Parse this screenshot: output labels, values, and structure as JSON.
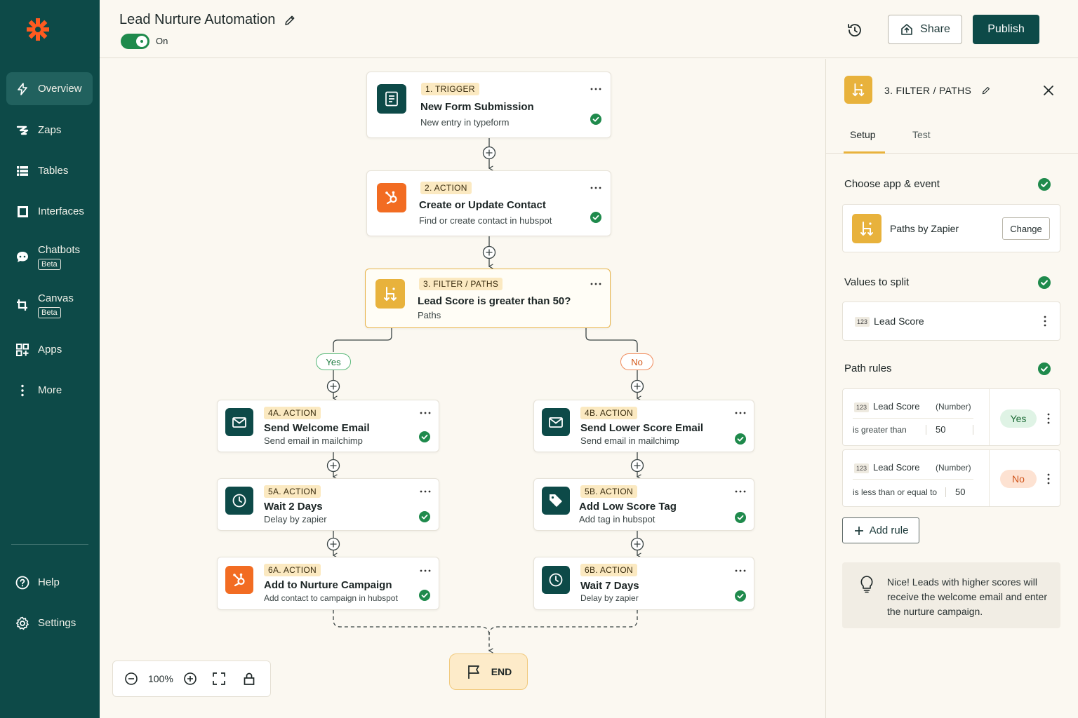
{
  "sidebar": {
    "items": [
      {
        "label": "Overview",
        "icon": "bolt-icon"
      },
      {
        "label": "Zaps",
        "icon": "zap-icon"
      },
      {
        "label": "Tables",
        "icon": "tables-icon"
      },
      {
        "label": "Interfaces",
        "icon": "interfaces-icon"
      },
      {
        "label": "Chatbots",
        "badge": "Beta",
        "icon": "chatbot-icon"
      },
      {
        "label": "Canvas",
        "badge": "Beta",
        "icon": "canvas-icon"
      },
      {
        "label": "Apps",
        "icon": "apps-icon"
      },
      {
        "label": "More",
        "icon": "more-vertical-icon"
      }
    ],
    "footer": [
      {
        "label": "Help",
        "icon": "help-icon"
      },
      {
        "label": "Settings",
        "icon": "gear-icon"
      }
    ]
  },
  "header": {
    "title": "Lead Nurture Automation",
    "toggle_label": "On",
    "share_label": "Share",
    "publish_label": "Publish"
  },
  "steps": {
    "s1": {
      "label": "1. TRIGGER",
      "title": "New Form Submission",
      "sub": "New entry in typeform"
    },
    "s2": {
      "label": "2. ACTION",
      "title": "Create or Update Contact",
      "sub": "Find or create contact in hubspot"
    },
    "s3": {
      "label": "3. FILTER / PATHS",
      "title": "Lead Score is greater than 50?",
      "sub": "Paths"
    },
    "s4a": {
      "label": "4A. ACTION",
      "title": "Send Welcome Email",
      "sub": "Send email in mailchimp"
    },
    "s5a": {
      "label": "5A. ACTION",
      "title": "Wait 2 Days",
      "sub": "Delay by zapier"
    },
    "s6a": {
      "label": "6A. ACTION",
      "title": "Add to Nurture Campaign",
      "sub": "Add contact to campaign in hubspot"
    },
    "s4b": {
      "label": "4B. ACTION",
      "title": "Send Lower Score Email",
      "sub": "Send email in mailchimp"
    },
    "s5b": {
      "label": "5B. ACTION",
      "title": "Add Low Score Tag",
      "sub": "Add tag in hubspot"
    },
    "s6b": {
      "label": "6B. ACTION",
      "title": "Wait 7 Days",
      "sub": "Delay by zapier"
    }
  },
  "branches": {
    "yes": "Yes",
    "no": "No"
  },
  "end_label": "END",
  "zoom": {
    "value": "100%"
  },
  "panel": {
    "title": "3. FILTER / PATHS",
    "tabs": [
      "Setup",
      "Test"
    ],
    "choose_app_heading": "Choose app & event",
    "app_name": "Paths by Zapier",
    "change_label": "Change",
    "values_heading": "Values to split",
    "value_tag": "123",
    "value_field": "Lead Score",
    "path_rules_heading": "Path rules",
    "rules": [
      {
        "tag": "123",
        "field": "Lead Score",
        "type": "(Number)",
        "operator": "is greater than",
        "value": "50",
        "path": "Yes"
      },
      {
        "tag": "123",
        "field": "Lead Score",
        "type": "(Number)",
        "operator": "is less than or equal to",
        "value": "50",
        "path": "No"
      }
    ],
    "add_rule_label": "Add rule",
    "tip": "Nice! Leads with higher scores will receive the welcome email and enter the nurture campaign."
  },
  "colors": {
    "sidebar": "#0d4a48",
    "accent": "#e8b23c",
    "success": "#1f8a4c",
    "hubspot": "#f26c22",
    "no_branch": "#d35516"
  }
}
